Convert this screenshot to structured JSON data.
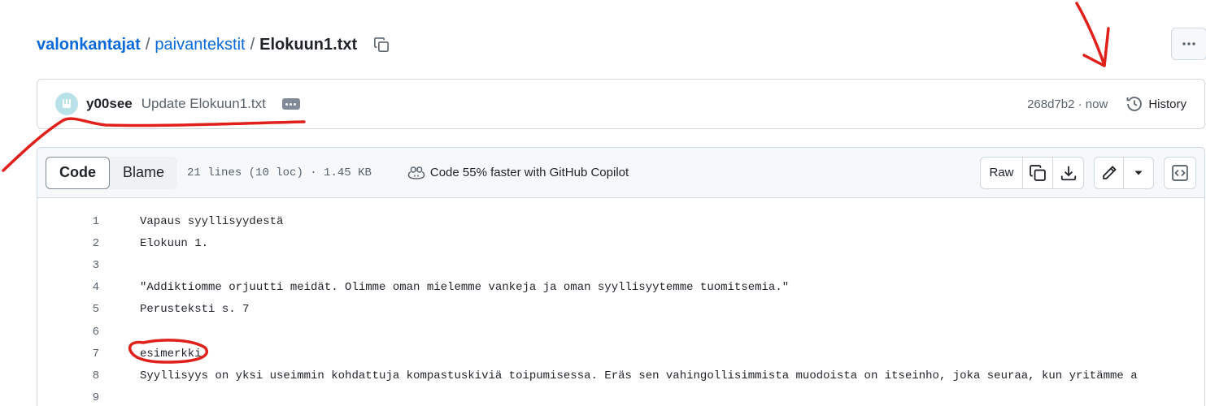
{
  "breadcrumb": {
    "owner": "valonkantajat",
    "folder": "paivantekstit",
    "file": "Elokuun1.txt",
    "separator": "/"
  },
  "commit": {
    "author": "y00see",
    "message": "Update Elokuun1.txt",
    "sha": "268d7b2",
    "time": "now",
    "sha_time": "268d7b2 · now",
    "history_label": "History"
  },
  "file_header": {
    "tabs": [
      {
        "label": "Code",
        "active": true
      },
      {
        "label": "Blame",
        "active": false
      }
    ],
    "meta": "21 lines (10 loc) · 1.45 KB",
    "copilot": "Code 55% faster with GitHub Copilot",
    "raw_label": "Raw"
  },
  "code_lines": [
    {
      "n": "1",
      "text": "Vapaus syyllisyydestä"
    },
    {
      "n": "2",
      "text": "Elokuun 1."
    },
    {
      "n": "3",
      "text": ""
    },
    {
      "n": "4",
      "text": "\"Addiktiomme orjuutti meidät. Olimme oman mielemme vankeja ja oman syyllisyytemme tuomitsemia.\""
    },
    {
      "n": "5",
      "text": "Perusteksti s. 7"
    },
    {
      "n": "6",
      "text": ""
    },
    {
      "n": "7",
      "text": "esimerkki"
    },
    {
      "n": "8",
      "text": "Syyllisyys on yksi useimmin kohdattuja kompastuskiviä toipumisessa. Eräs sen vahingollisimmista muodoista on itseinho, joka seuraa, kun yritämme a"
    },
    {
      "n": "9",
      "text": ""
    }
  ],
  "colors": {
    "link": "#0969da",
    "muted": "#59636e",
    "annotation": "#e0211b"
  }
}
